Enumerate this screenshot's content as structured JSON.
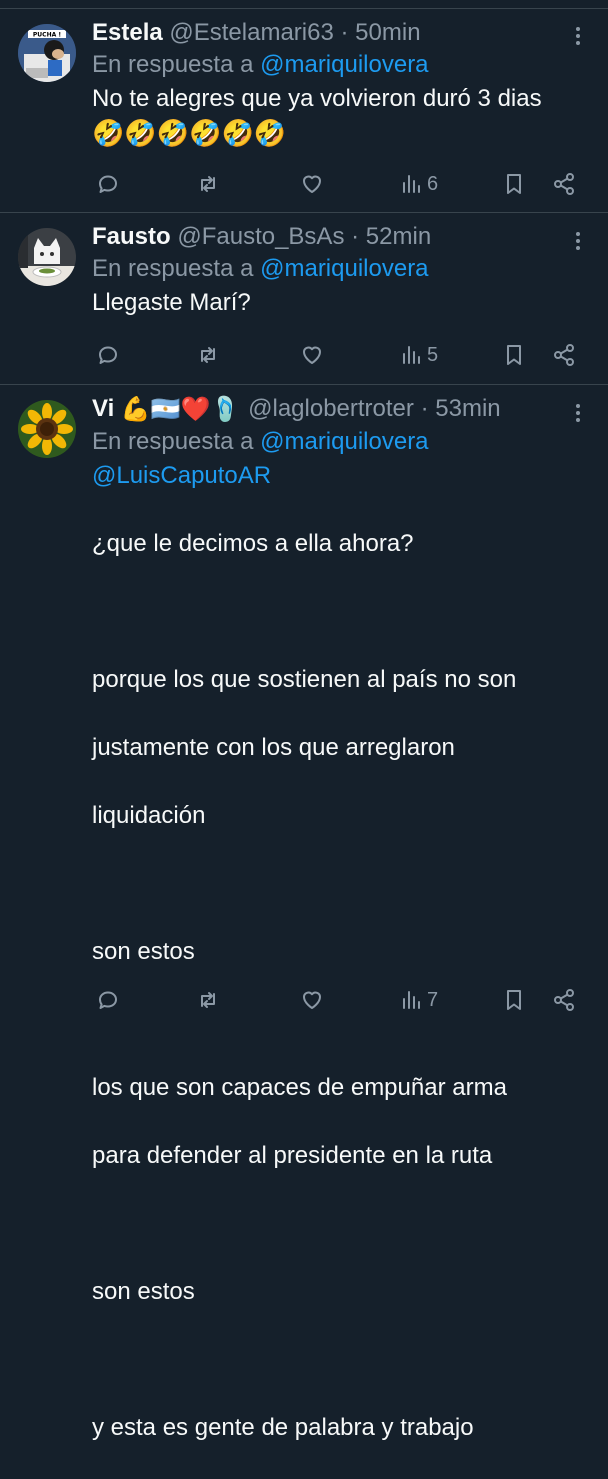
{
  "colors": {
    "background": "#15202b",
    "text": "#f7f9f9",
    "muted": "#8b98a5",
    "link": "#1d9bf0",
    "divider": "#38444d"
  },
  "tweets": [
    {
      "name": "Estela",
      "handle": "@Estelamari63",
      "separator": "·",
      "time": "50min",
      "reply_prefix": "En respuesta a",
      "reply_to": "@mariquilovera",
      "text": "No te alegres  que ya volvieron duró  3 dias",
      "emoji_line": "🤣🤣🤣🤣🤣🤣",
      "avatar_icon": "goofy-avatar",
      "views": "6"
    },
    {
      "name": "Fausto",
      "handle": "@Fausto_BsAs",
      "separator": "·",
      "time": "52min",
      "reply_prefix": "En respuesta a",
      "reply_to": "@mariquilovera",
      "text": "Llegaste Marí?",
      "avatar_icon": "cat-at-table-avatar",
      "views": "5"
    },
    {
      "name": "Vi",
      "name_emojis": "💪🇦🇷❤️🩴",
      "handle": "@laglobertroter",
      "separator": "·",
      "time": "53min",
      "reply_prefix": "En respuesta a",
      "reply_to": "@mariquilovera",
      "reply_to_2": "@LuisCaputoAR",
      "lines": [
        "¿que le decimos a ella ahora?",
        "porque los que sostienen al país no son",
        "justamente con los que arreglaron",
        "liquidación",
        "son estos",
        "los que son capaces de empuñar arma",
        "para defender al presidente en la ruta",
        "son estos",
        "y esta es gente de palabra y trabajo"
      ],
      "avatar_icon": "sunflower-avatar",
      "views": "7"
    }
  ]
}
